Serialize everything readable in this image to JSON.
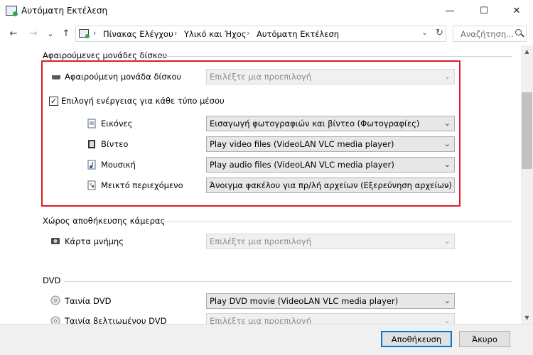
{
  "window": {
    "title": "Αυτόματη Εκτέλεση",
    "minimize": "—",
    "maximize": "☐",
    "close": "✕"
  },
  "nav": {
    "back": "←",
    "forward": "→",
    "down": "⌄",
    "up": "↑",
    "breadcrumbs": [
      "Πίνακας Ελέγχου",
      "Υλικό και Ήχος",
      "Αυτόματη Εκτέλεση"
    ],
    "separator": "›",
    "dropdown": "⌄",
    "refresh": "↻",
    "search_placeholder": "Αναζήτηση..."
  },
  "removable": {
    "section_title": "Αφαιρούμενες μονάδες δίσκου",
    "drive_label": "Αφαιρούμενη μονάδα δίσκου",
    "drive_value": "Επιλέξτε μια προεπιλογή",
    "checkbox_label": "Επιλογή ενέργειας για κάθε τύπο μέσου",
    "checkbox_checked": true,
    "checkmark": "✓",
    "media": [
      {
        "label": "Εικόνες",
        "value": "Εισαγωγή φωτογραφιών και βίντεο (Φωτογραφίες)"
      },
      {
        "label": "Βίντεο",
        "value": "Play video files (VideoLAN VLC media player)"
      },
      {
        "label": "Μουσική",
        "value": "Play audio files (VideoLAN VLC media player)"
      },
      {
        "label": "Μεικτό περιεχόμενο",
        "value": "Άνοιγμα φακέλου για πρ/λή αρχείων (Εξερεύνηση αρχείων)"
      }
    ]
  },
  "camera": {
    "section_title": "Χώρος αποθήκευσης κάμερας",
    "label": "Κάρτα μνήμης",
    "value": "Επιλέξτε μια προεπιλογή"
  },
  "dvd": {
    "section_title": "DVD",
    "items": [
      {
        "label": "Ταινία DVD",
        "value": "Play DVD movie (VideoLAN VLC media player)"
      },
      {
        "label": "Ταινία βελτιωμένου DVD",
        "value": "Επιλέξτε μια προεπιλογή"
      }
    ]
  },
  "chevron": "⌄",
  "scrollbar": {
    "up": "▲",
    "down": "▼"
  },
  "footer": {
    "save": "Αποθήκευση",
    "cancel": "Άκυρο"
  },
  "colors": {
    "highlight": "#e01b24",
    "accent": "#0078d7"
  }
}
